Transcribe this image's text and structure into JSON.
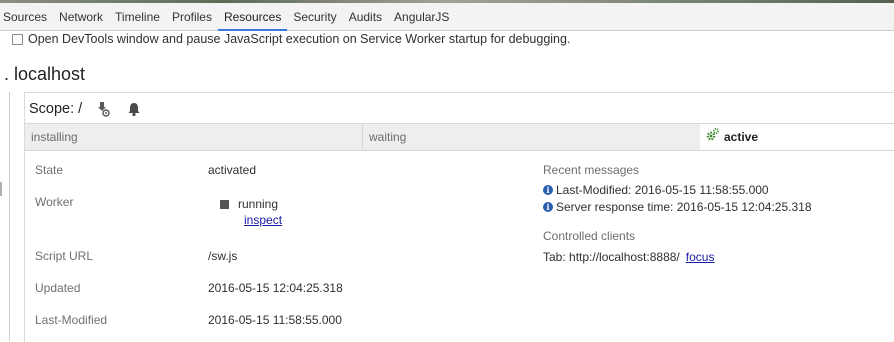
{
  "tabs": [
    {
      "label": "Sources"
    },
    {
      "label": "Network"
    },
    {
      "label": "Timeline"
    },
    {
      "label": "Profiles"
    },
    {
      "label": "Resources",
      "selected": true
    },
    {
      "label": "Security"
    },
    {
      "label": "Audits"
    },
    {
      "label": "AngularJS"
    }
  ],
  "options": {
    "pause_on_startup_label": "Open DevTools window and pause JavaScript execution on Service Worker startup for debugging.",
    "pause_on_startup_checked": false
  },
  "origin": {
    "bullet": ".",
    "title": "localhost"
  },
  "registration": {
    "scope_label": "Scope: /",
    "icons": [
      "push-icon",
      "sync-bell-icon"
    ],
    "status_bar": {
      "installing": "installing",
      "waiting": "waiting",
      "active": "active"
    },
    "details": {
      "state_label": "State",
      "state_value": "activated",
      "worker_label": "Worker",
      "worker_status": "running",
      "worker_inspect": "inspect",
      "script_url_label": "Script URL",
      "script_url_value": "/sw.js",
      "updated_label": "Updated",
      "updated_value": "2016-05-15 12:04:25.318",
      "last_modified_label": "Last-Modified",
      "last_modified_value": "2016-05-15 11:58:55.000"
    },
    "recent_messages_label": "Recent messages",
    "messages": [
      "Last-Modified: 2016-05-15 11:58:55.000",
      "Server response time: 2016-05-15 12:04:25.318"
    ],
    "controlled_clients_label": "Controlled clients",
    "client_text": "Tab: http://localhost:8888/",
    "client_focus": "focus"
  },
  "colors": {
    "selected_tab_accent": "#3879d9",
    "active_gear": "#3b8a2a",
    "info_icon": "#2a5db0",
    "link": "#1a1aa6"
  }
}
